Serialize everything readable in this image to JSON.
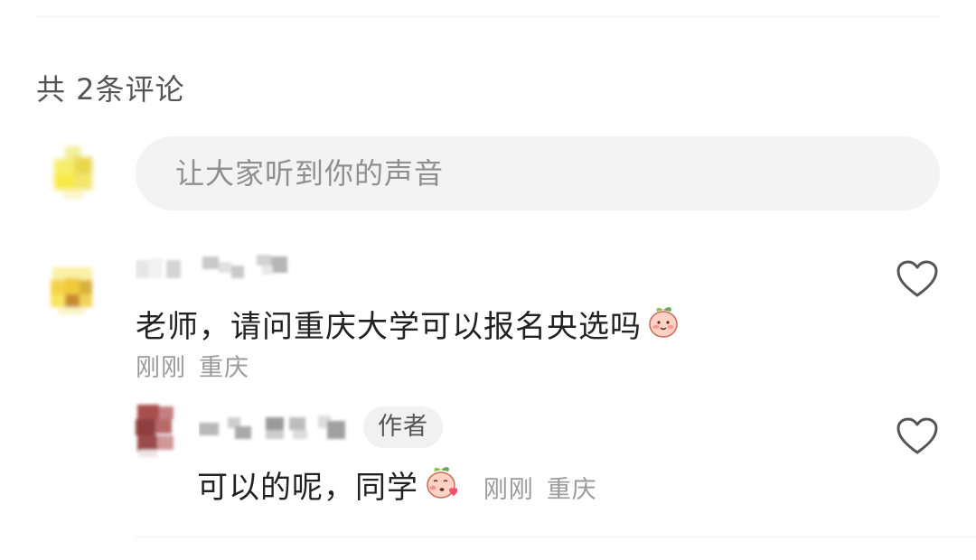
{
  "comments_header": {
    "total_label": "共 2条评论"
  },
  "compose": {
    "placeholder": "让大家听到你的声音"
  },
  "comments": [
    {
      "text": "老师，请问重庆大学可以报名央选吗",
      "emoji": "peach-smile-emoji",
      "time": "刚刚",
      "location": "重庆",
      "like_icon": "heart-outline-icon"
    }
  ],
  "replies": [
    {
      "author_tag": "作者",
      "text": "可以的呢，同学",
      "emoji": "peach-blush-emoji",
      "time": "刚刚",
      "location": "重庆",
      "like_icon": "heart-outline-icon"
    }
  ]
}
